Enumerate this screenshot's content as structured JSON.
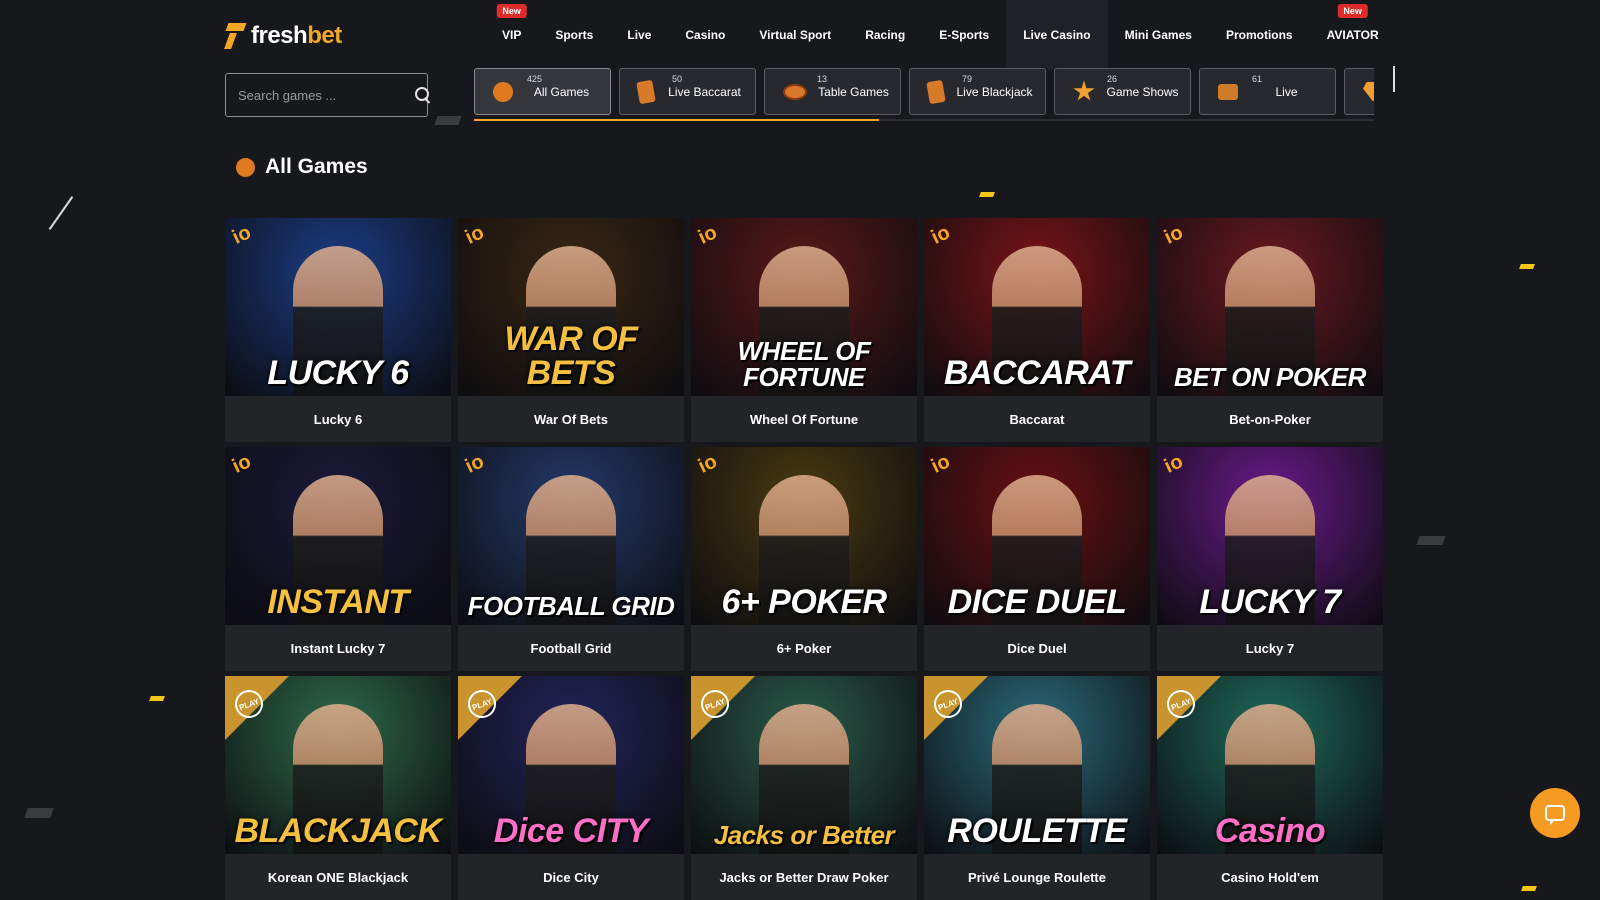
{
  "brand": {
    "part1": "fresh",
    "part2": "bet"
  },
  "nav": [
    {
      "label": "VIP",
      "badge": "New"
    },
    {
      "label": "Sports"
    },
    {
      "label": "Live"
    },
    {
      "label": "Casino"
    },
    {
      "label": "Virtual Sport"
    },
    {
      "label": "Racing"
    },
    {
      "label": "E-Sports"
    },
    {
      "label": "Live Casino",
      "active": true
    },
    {
      "label": "Mini Games"
    },
    {
      "label": "Promotions"
    },
    {
      "label": "AVIATOR",
      "badge": "New"
    }
  ],
  "search": {
    "placeholder": "Search games ..."
  },
  "categories": [
    {
      "count": "425",
      "label": "All Games",
      "icon": "ball-icon"
    },
    {
      "count": "50",
      "label": "Live Baccarat",
      "icon": "card-icon"
    },
    {
      "count": "13",
      "label": "Table Games",
      "icon": "table-icon"
    },
    {
      "count": "79",
      "label": "Live Blackjack",
      "icon": "card-icon"
    },
    {
      "count": "26",
      "label": "Game Shows",
      "icon": "star-icon"
    },
    {
      "count": "61",
      "label": "Live",
      "icon": "camera-icon"
    },
    {
      "count": "",
      "label": "",
      "icon": "gem-icon"
    }
  ],
  "section": {
    "title": "All Games"
  },
  "games": [
    {
      "name": "Lucky 6",
      "thumb": "LUCKY 6",
      "provider": "io",
      "bg": "#1b3d86"
    },
    {
      "name": "War Of Bets",
      "thumb": "WAR OF BETS",
      "provider": "io",
      "bg": "#3a2612"
    },
    {
      "name": "Wheel Of Fortune",
      "thumb": "WHEEL OF FORTUNE",
      "provider": "io",
      "bg": "#5a1818"
    },
    {
      "name": "Baccarat",
      "thumb": "BACCARAT",
      "provider": "io",
      "bg": "#7a1416"
    },
    {
      "name": "Bet-on-Poker",
      "thumb": "BET ON POKER",
      "provider": "io",
      "bg": "#6a1820"
    },
    {
      "name": "Instant Lucky 7",
      "thumb": "INSTANT",
      "provider": "io",
      "bg": "#1a1a3a"
    },
    {
      "name": "Football Grid",
      "thumb": "FOOTBALL GRID",
      "provider": "io",
      "bg": "#243a6a"
    },
    {
      "name": "6+ Poker",
      "thumb": "6+ POKER",
      "provider": "io",
      "bg": "#4a3a10"
    },
    {
      "name": "Dice Duel",
      "thumb": "DICE DUEL",
      "provider": "io",
      "bg": "#6a1012"
    },
    {
      "name": "Lucky 7",
      "thumb": "LUCKY 7",
      "provider": "io",
      "bg": "#6a1a8a"
    },
    {
      "name": "Korean ONE Blackjack",
      "thumb": "BLACKJACK",
      "provider": "play",
      "bg": "#2e6a4a"
    },
    {
      "name": "Dice City",
      "thumb": "Dice CITY",
      "provider": "play",
      "bg": "#22245a"
    },
    {
      "name": "Jacks or Better Draw Poker",
      "thumb": "Jacks or Better",
      "provider": "play",
      "bg": "#2a5a4a"
    },
    {
      "name": "Privé Lounge Roulette",
      "thumb": "ROULETTE",
      "provider": "play",
      "bg": "#2a6a7a"
    },
    {
      "name": "Casino Hold'em",
      "thumb": "Casino",
      "provider": "play",
      "bg": "#1e6a5a"
    }
  ],
  "play_badge": "PLAY"
}
